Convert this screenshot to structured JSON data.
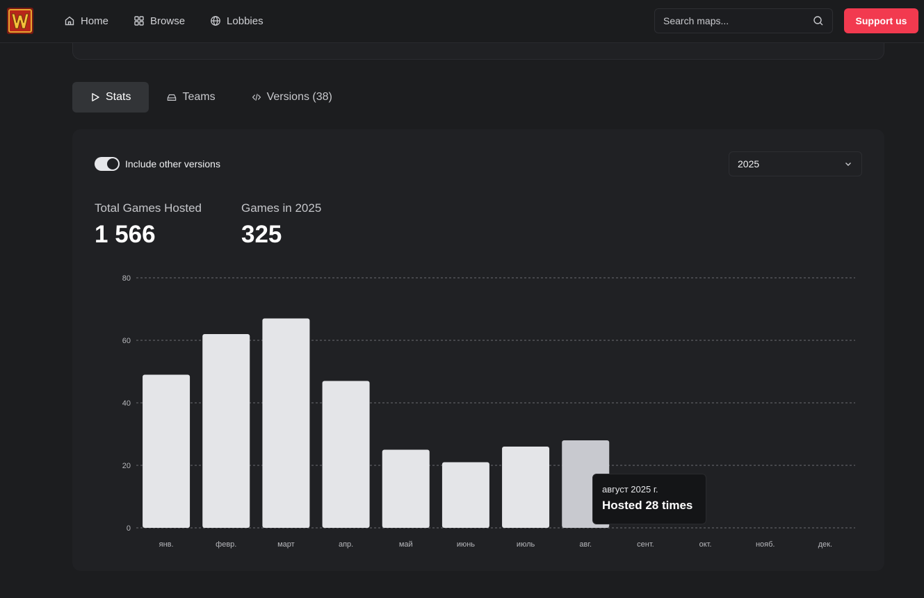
{
  "header": {
    "nav": [
      {
        "label": "Home",
        "icon": "home-icon"
      },
      {
        "label": "Browse",
        "icon": "grid-icon"
      },
      {
        "label": "Lobbies",
        "icon": "globe-icon"
      }
    ],
    "search_placeholder": "Search maps...",
    "support_label": "Support us",
    "accent": "#f23a4f"
  },
  "tabs": [
    {
      "label": "Stats",
      "icon": "play-icon",
      "active": true
    },
    {
      "label": "Teams",
      "icon": "hard-drive-icon",
      "active": false
    },
    {
      "label": "Versions (38)",
      "icon": "code-icon",
      "active": false
    }
  ],
  "stats": {
    "toggle_label": "Include other versions",
    "toggle_on": true,
    "year_selected": "2025",
    "total_label": "Total Games Hosted",
    "total_value": "1 566",
    "year_label": "Games in 2025",
    "year_value": "325"
  },
  "tooltip": {
    "date": "август 2025 г.",
    "text": "Hosted 28 times"
  },
  "chart_data": {
    "type": "bar",
    "categories": [
      "янв.",
      "февр.",
      "март",
      "апр.",
      "май",
      "июнь",
      "июль",
      "авг.",
      "сент.",
      "окт.",
      "нояб.",
      "дек."
    ],
    "values": [
      49,
      62,
      67,
      47,
      25,
      21,
      26,
      28,
      0,
      0,
      0,
      0
    ],
    "ylim": [
      0,
      80
    ],
    "yticks": [
      0,
      20,
      40,
      60,
      80
    ],
    "grid": true,
    "highlighted_index": 7,
    "bar_color": "#e4e5e8",
    "highlight_color": "#c8c9cf"
  }
}
